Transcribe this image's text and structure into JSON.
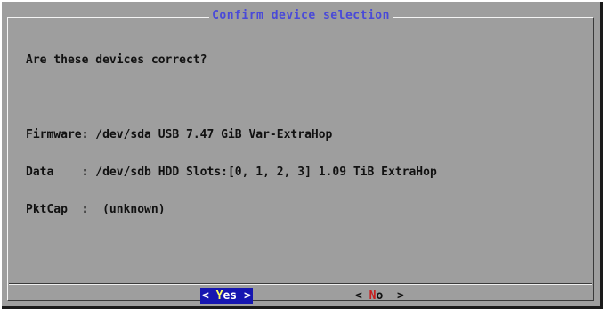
{
  "dialog": {
    "title": "Confirm device selection",
    "prompt": "Are these devices correct?",
    "lines": [
      "",
      "Firmware: /dev/sda USB 7.47 GiB Var-ExtraHop",
      "Data    : /dev/sdb HDD Slots:[0, 1, 2, 3] 1.09 TiB ExtraHop",
      "PktCap  :  (unknown)"
    ]
  },
  "buttons": {
    "yes": {
      "open": "< ",
      "hot": "Y",
      "rest": "es",
      "close": " >"
    },
    "no": {
      "open": "< ",
      "hot": "N",
      "rest": "o",
      "close": "  >"
    }
  },
  "colors": {
    "dialog_bg": "#9e9e9e",
    "title": "#4a4ad8",
    "selected_button_bg": "#1616b0",
    "selected_hotkey": "#ffff66",
    "hotkey": "#c81e1e"
  }
}
